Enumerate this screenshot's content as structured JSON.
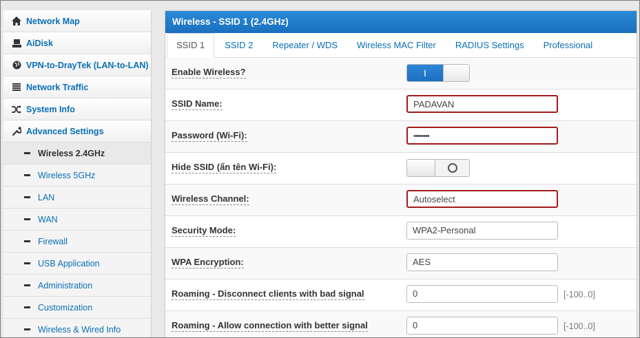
{
  "sidebar": {
    "items": [
      {
        "label": "Network Map",
        "icon": "home-icon"
      },
      {
        "label": "AiDisk",
        "icon": "disk-icon"
      },
      {
        "label": "VPN-to-DrayTek (LAN-to-LAN)",
        "icon": "globe-icon"
      },
      {
        "label": "Network Traffic",
        "icon": "list-icon"
      },
      {
        "label": "System Info",
        "icon": "shuffle-icon"
      },
      {
        "label": "Advanced Settings",
        "icon": "wrench-icon"
      }
    ],
    "sub_items": [
      {
        "label": "Wireless 2.4GHz",
        "active": true
      },
      {
        "label": "Wireless 5GHz"
      },
      {
        "label": "LAN"
      },
      {
        "label": "WAN"
      },
      {
        "label": "Firewall"
      },
      {
        "label": "USB Application"
      },
      {
        "label": "Administration"
      },
      {
        "label": "Customization"
      },
      {
        "label": "Wireless & Wired Info"
      }
    ]
  },
  "panel": {
    "title": "Wireless - SSID 1 (2.4GHz)",
    "tabs": [
      "SSID 1",
      "SSID 2",
      "Repeater / WDS",
      "Wireless MAC Filter",
      "RADIUS Settings",
      "Professional"
    ],
    "active_tab": "SSID 1"
  },
  "form": {
    "enable_wireless": {
      "label": "Enable Wireless?",
      "state_glyph": "I",
      "enabled": true
    },
    "ssid_name": {
      "label": "SSID Name:",
      "value": "PADAVAN"
    },
    "password": {
      "label": "Password (Wi-Fi):",
      "value": "••••••••"
    },
    "hide_ssid": {
      "label": "Hide SSID (ẩn tên Wi-Fi):",
      "enabled": false
    },
    "channel": {
      "label": "Wireless Channel:",
      "value": "Autoselect"
    },
    "security_mode": {
      "label": "Security Mode:",
      "value": "WPA2-Personal"
    },
    "wpa_encryption": {
      "label": "WPA Encryption:",
      "value": "AES"
    },
    "roam_disconnect": {
      "label": "Roaming - Disconnect clients with bad signal",
      "value": "0",
      "range": "[-100..0]"
    },
    "roam_allow": {
      "label": "Roaming - Allow connection with better signal",
      "value": "0",
      "range": "[-100..0]"
    }
  },
  "colors": {
    "accent": "#1a6fbd",
    "link": "#0a6fb6",
    "highlight_border": "#a31a1a"
  }
}
